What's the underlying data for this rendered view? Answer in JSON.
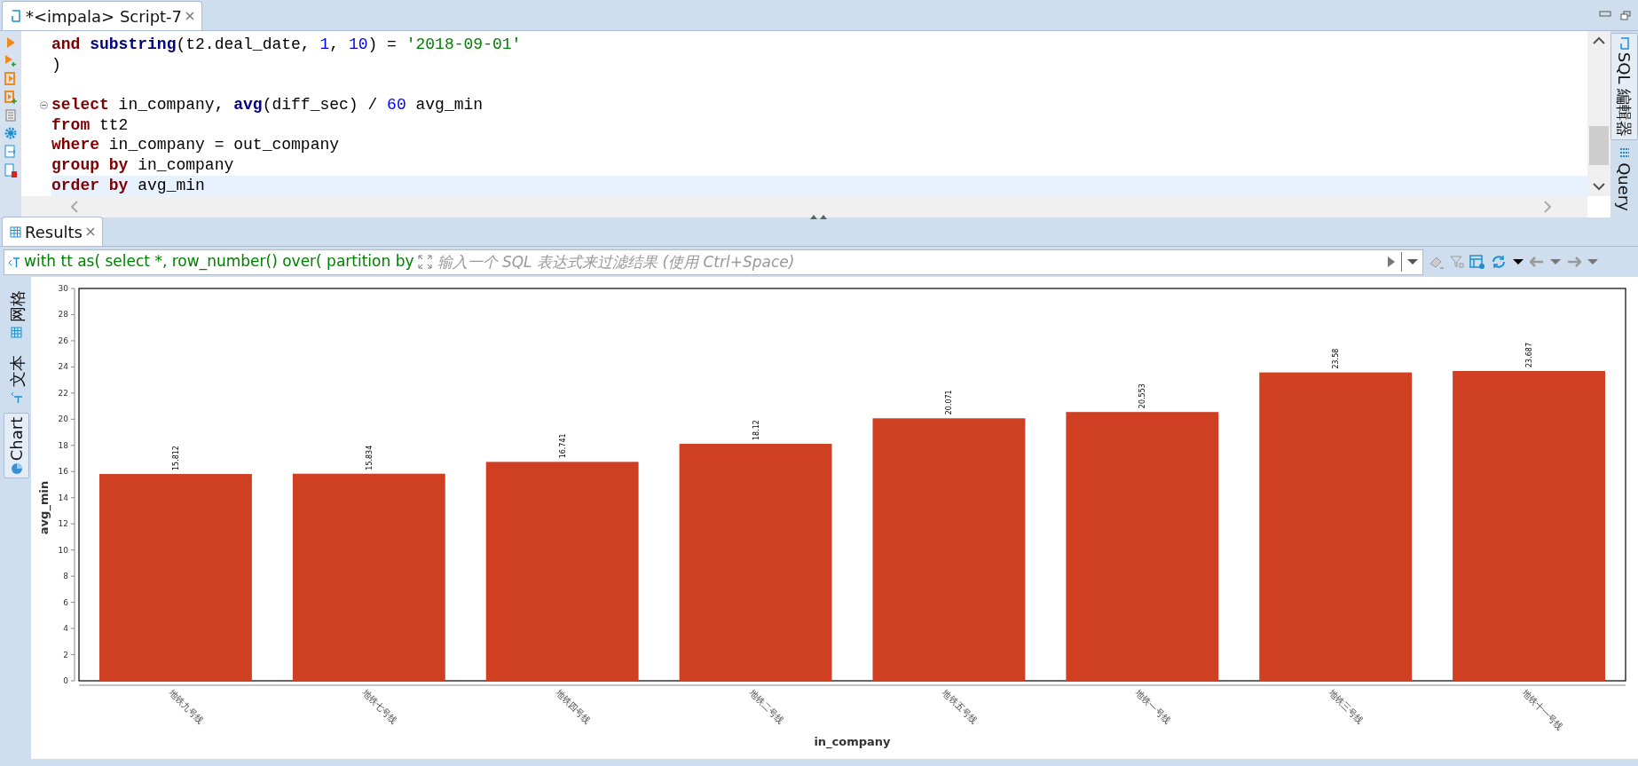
{
  "editor_tab": {
    "title": "*<impala> Script-7",
    "selected": true
  },
  "code_lines": [
    {
      "kind": "code",
      "current": false,
      "foldable": false,
      "tokens": [
        {
          "text": "and ",
          "kind": "keyword"
        },
        {
          "text": "substring",
          "kind": "function"
        },
        {
          "text": "(t2.deal_date, ",
          "kind": "plain"
        },
        {
          "text": "1",
          "kind": "number"
        },
        {
          "text": ", ",
          "kind": "plain"
        },
        {
          "text": "10",
          "kind": "number"
        },
        {
          "text": ") = ",
          "kind": "plain"
        },
        {
          "text": "'2018-09-01'",
          "kind": "string"
        }
      ]
    },
    {
      "kind": "code",
      "current": false,
      "foldable": false,
      "tokens": [
        {
          "text": ")",
          "kind": "plain"
        }
      ]
    },
    {
      "kind": "blank"
    },
    {
      "kind": "code",
      "current": false,
      "foldable": true,
      "tokens": [
        {
          "text": "select",
          "kind": "keyword"
        },
        {
          "text": " in_company, ",
          "kind": "plain"
        },
        {
          "text": "avg",
          "kind": "function"
        },
        {
          "text": "(diff_sec) / ",
          "kind": "plain"
        },
        {
          "text": "60",
          "kind": "number"
        },
        {
          "text": " avg_min",
          "kind": "plain"
        }
      ]
    },
    {
      "kind": "code",
      "current": false,
      "foldable": false,
      "tokens": [
        {
          "text": "from",
          "kind": "keyword"
        },
        {
          "text": " tt2",
          "kind": "plain"
        }
      ]
    },
    {
      "kind": "code",
      "current": false,
      "foldable": false,
      "tokens": [
        {
          "text": "where",
          "kind": "keyword"
        },
        {
          "text": " in_company = out_company",
          "kind": "plain"
        }
      ]
    },
    {
      "kind": "code",
      "current": false,
      "foldable": false,
      "tokens": [
        {
          "text": "group by",
          "kind": "keyword"
        },
        {
          "text": " in_company",
          "kind": "plain"
        }
      ]
    },
    {
      "kind": "code",
      "current": true,
      "foldable": false,
      "tokens": [
        {
          "text": "order by",
          "kind": "keyword"
        },
        {
          "text": " avg_min",
          "kind": "plain"
        }
      ]
    }
  ],
  "side_tabs_right": [
    {
      "label": "SQL 編輯器",
      "selected": true
    },
    {
      "label": "Query",
      "selected": false
    }
  ],
  "results_tab": {
    "title": "Results"
  },
  "filter": {
    "query": "with tt as( select *, row_number() over( partition by",
    "placeholder": "输入一个 SQL 表达式来过滤结果 (使用 Ctrl+Space)"
  },
  "side_tabs_left": [
    {
      "label": "网格",
      "kind": "grid",
      "selected": false
    },
    {
      "label": "文本",
      "kind": "text",
      "selected": false
    },
    {
      "label": "Chart",
      "kind": "chart",
      "selected": true
    }
  ],
  "chart": {
    "chart_data": {
      "type": "bar",
      "xlabel": "in_company",
      "ylabel": "avg_min",
      "categories": [
        "地铁九号线",
        "地铁七号线",
        "地铁四号线",
        "地铁二号线",
        "地铁五号线",
        "地铁一号线",
        "地铁三号线",
        "地铁十一号线"
      ],
      "series": [
        {
          "color": "#cf3f22",
          "values": [
            15.812,
            15.834,
            16.741,
            18.12,
            20.071,
            20.553,
            23.58,
            23.687
          ]
        }
      ],
      "ylim": [
        0,
        30
      ],
      "yticks": [
        0,
        2,
        4,
        6,
        8,
        10,
        12,
        14,
        16,
        18,
        20,
        22,
        24,
        26,
        28,
        30
      ],
      "data_labels": true
    }
  }
}
